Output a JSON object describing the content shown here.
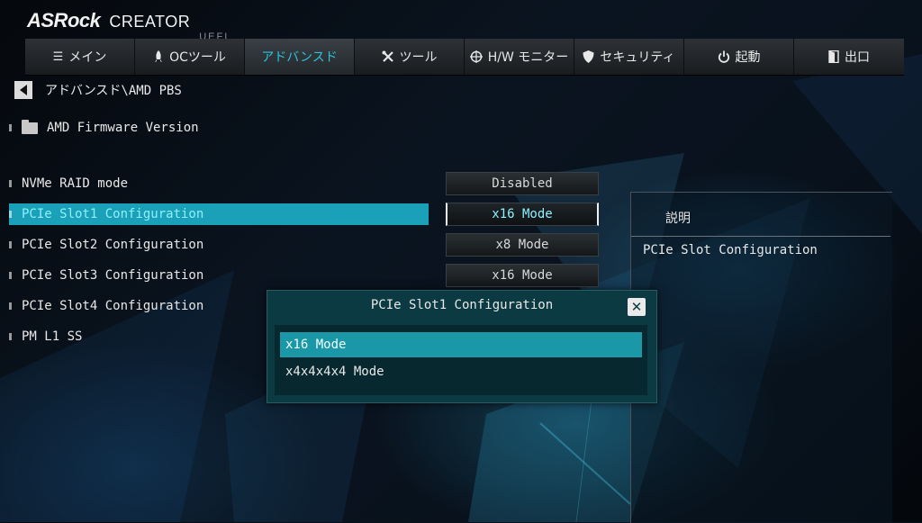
{
  "header": {
    "brand": "ASRock",
    "line": "CREATOR",
    "firmware": "UEFI"
  },
  "tabs": [
    {
      "label": "メイン",
      "icon": "list-icon",
      "active": false
    },
    {
      "label": "OCツール",
      "icon": "rocket-icon",
      "active": false
    },
    {
      "label": "アドバンスド",
      "icon": "",
      "active": true
    },
    {
      "label": "ツール",
      "icon": "tools-icon",
      "active": false
    },
    {
      "label": "H/W モニター",
      "icon": "crosshair-icon",
      "active": false
    },
    {
      "label": "セキュリティ",
      "icon": "shield-icon",
      "active": false
    },
    {
      "label": "起動",
      "icon": "power-icon",
      "active": false
    },
    {
      "label": "出口",
      "icon": "exit-door-icon",
      "active": false
    }
  ],
  "breadcrumb": "アドバンスド\\AMD PBS",
  "firmware_item": "AMD Firmware Version",
  "settings": [
    {
      "label": "NVMe RAID mode",
      "value": "Disabled"
    },
    {
      "label": "PCIe Slot1 Configuration",
      "value": "x16 Mode",
      "selected": true
    },
    {
      "label": "PCIe Slot2 Configuration",
      "value": "x8 Mode"
    },
    {
      "label": "PCIe Slot3 Configuration",
      "value": "x16 Mode"
    },
    {
      "label": "PCIe Slot4 Configuration",
      "value": ""
    },
    {
      "label": "PM L1 SS",
      "value": ""
    }
  ],
  "description": {
    "title": "説明",
    "text": "PCIe Slot Configuration"
  },
  "popup": {
    "title": "PCIe Slot1 Configuration",
    "options": [
      "x16 Mode",
      "x4x4x4x4 Mode"
    ],
    "selected_index": 0
  },
  "colors": {
    "accent": "#1aa0b8",
    "active_tab_text": "#2bc4dc",
    "popup_bg": "#0c3a42"
  }
}
